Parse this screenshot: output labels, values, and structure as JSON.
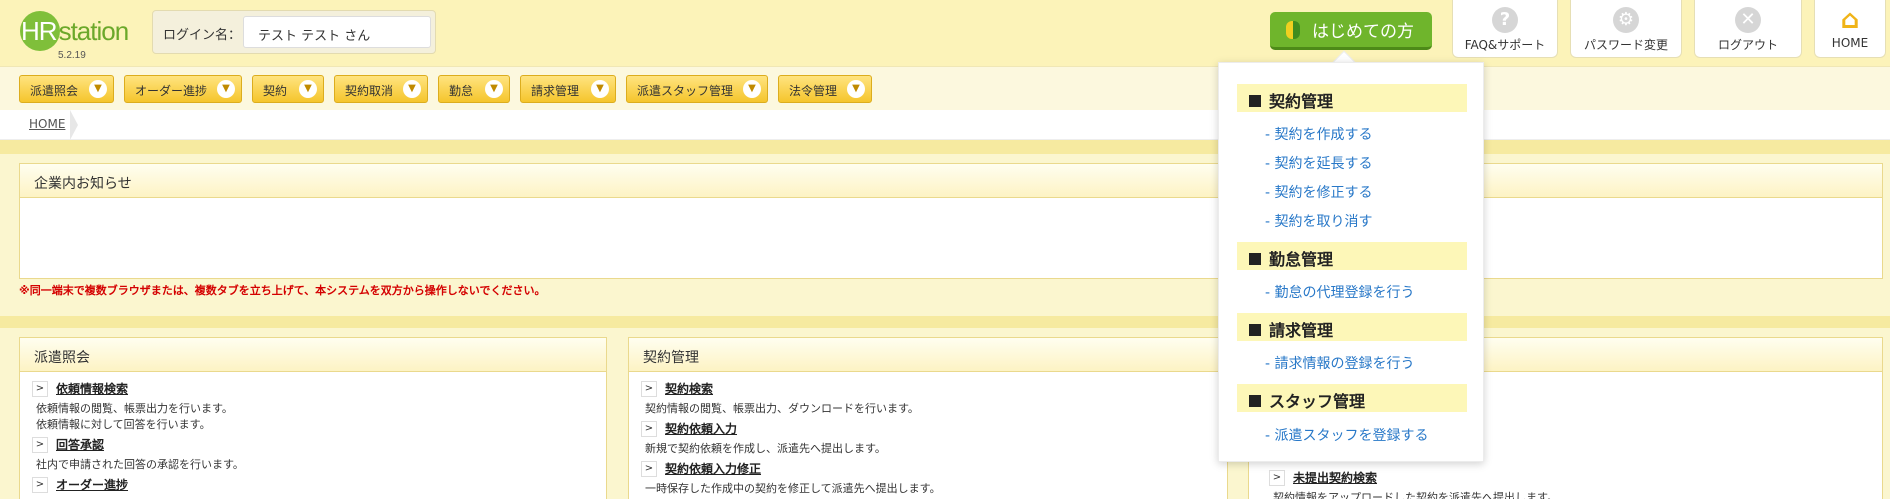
{
  "app": {
    "logo_hr": "HR",
    "logo_rest": "station",
    "version": "5.2.19"
  },
  "login": {
    "label": "ログイン名：",
    "value": "テスト テスト さん"
  },
  "start_button": "はじめての方",
  "top_buttons": [
    {
      "label": "FAQ&サポート",
      "icon": "help-icon",
      "glyph": "?"
    },
    {
      "label": "パスワード変更",
      "icon": "gear-icon",
      "glyph": "⚙"
    },
    {
      "label": "ログアウト",
      "icon": "close-icon",
      "glyph": "✕"
    },
    {
      "label": "HOME",
      "icon": "home-icon",
      "glyph": "⌂"
    }
  ],
  "nav": [
    "派遣照会",
    "オーダー進捗",
    "契約",
    "契約取消",
    "勤怠",
    "請求管理",
    "派遣スタッフ管理",
    "法令管理"
  ],
  "breadcrumb": {
    "home": "HOME"
  },
  "notice": {
    "title": "企業内お知らせ"
  },
  "warning": "※同一端末で複数ブラウザまたは、複数タブを立ち上げて、本システムを双方から操作しないでください。",
  "panels": {
    "haken": {
      "title": "派遣照会",
      "entries": [
        {
          "title": "依頼情報検索",
          "desc1": "依頼情報の閲覧、帳票出力を行います。",
          "desc2": "依頼情報に対して回答を行います。"
        },
        {
          "title": "回答承認",
          "desc1": "社内で申請された回答の承認を行います。"
        },
        {
          "title": "オーダー進捗"
        }
      ]
    },
    "keiyaku": {
      "title": "契約管理",
      "entries": [
        {
          "title": "契約検索",
          "desc1": "契約情報の閲覧、帳票出力、ダウンロードを行います。"
        },
        {
          "title": "契約依頼入力",
          "desc1": "新規で契約依頼を作成し、派遣先へ提出します。"
        },
        {
          "title": "契約依頼入力修正",
          "desc1": "一時保存した作成中の契約を修正して派遣先へ提出します。"
        }
      ]
    },
    "third": {
      "entries": [
        {
          "title": "未提出契約検索",
          "desc1": "契約情報をアップロードした契約を派遣先へ提出します。"
        }
      ]
    }
  },
  "popup": {
    "sections": [
      {
        "title": "契約管理",
        "links": [
          "- 契約を作成する",
          "- 契約を延長する",
          "- 契約を修正する",
          "- 契約を取り消す"
        ]
      },
      {
        "title": "勤怠管理",
        "links": [
          "- 勤怠の代理登録を行う"
        ]
      },
      {
        "title": "請求管理",
        "links": [
          "- 請求情報の登録を行う"
        ]
      },
      {
        "title": "スタッフ管理",
        "links": [
          "- 派遣スタッフを登録する"
        ]
      }
    ]
  }
}
